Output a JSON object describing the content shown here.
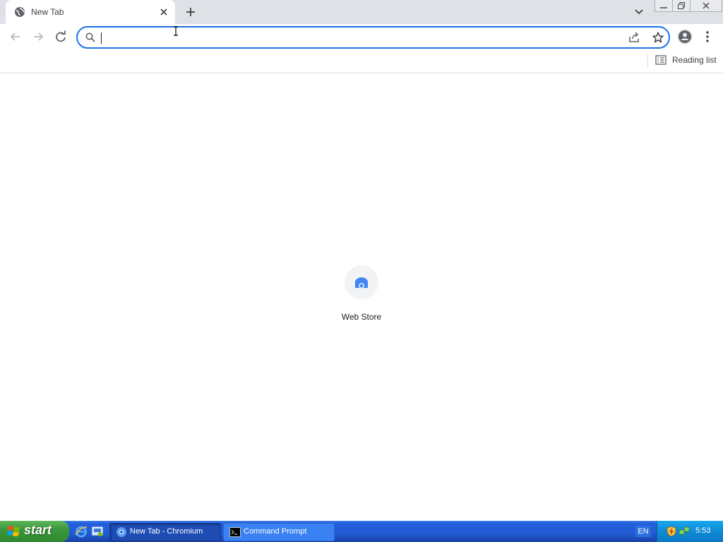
{
  "tab": {
    "title": "New Tab",
    "favicon": "globe-icon",
    "close_icon": "close-icon"
  },
  "tabstrip": {
    "new_tab_icon": "plus-icon",
    "tab_search_icon": "chevron-down-icon"
  },
  "window_controls": [
    "minimize-icon",
    "restore-icon",
    "close-icon"
  ],
  "toolbar": {
    "back_icon": "arrow-left-icon",
    "forward_icon": "arrow-right-icon",
    "reload_icon": "reload-icon",
    "omnibox": {
      "value": "",
      "placeholder": "",
      "search_icon": "search-icon",
      "share_icon": "share-icon",
      "bookmark_icon": "star-icon"
    },
    "profile_icon": "person-icon",
    "menu_icon": "kebab-menu-icon"
  },
  "bookmarks_bar": {
    "reading_list_label": "Reading list",
    "reading_list_icon": "reading-list-icon"
  },
  "new_tab_page": {
    "shortcuts": [
      {
        "label": "Web Store",
        "icon": "web-store-icon"
      }
    ]
  },
  "taskbar": {
    "start_label": "start",
    "quick_launch": [
      "internet-explorer-icon",
      "show-desktop-icon"
    ],
    "tasks": [
      {
        "label": "New Tab - Chromium",
        "icon": "chromium-icon",
        "active": true
      },
      {
        "label": "Command Prompt",
        "icon": "cmd-icon",
        "active": false
      }
    ],
    "language": "EN",
    "tray_icons": [
      "security-shield-icon",
      "network-icon"
    ],
    "clock": "5:53"
  },
  "colors": {
    "accent": "#1a73e8",
    "tabstrip": "#dee1e6",
    "taskbar": "#245edb",
    "start": "#3c973c"
  }
}
